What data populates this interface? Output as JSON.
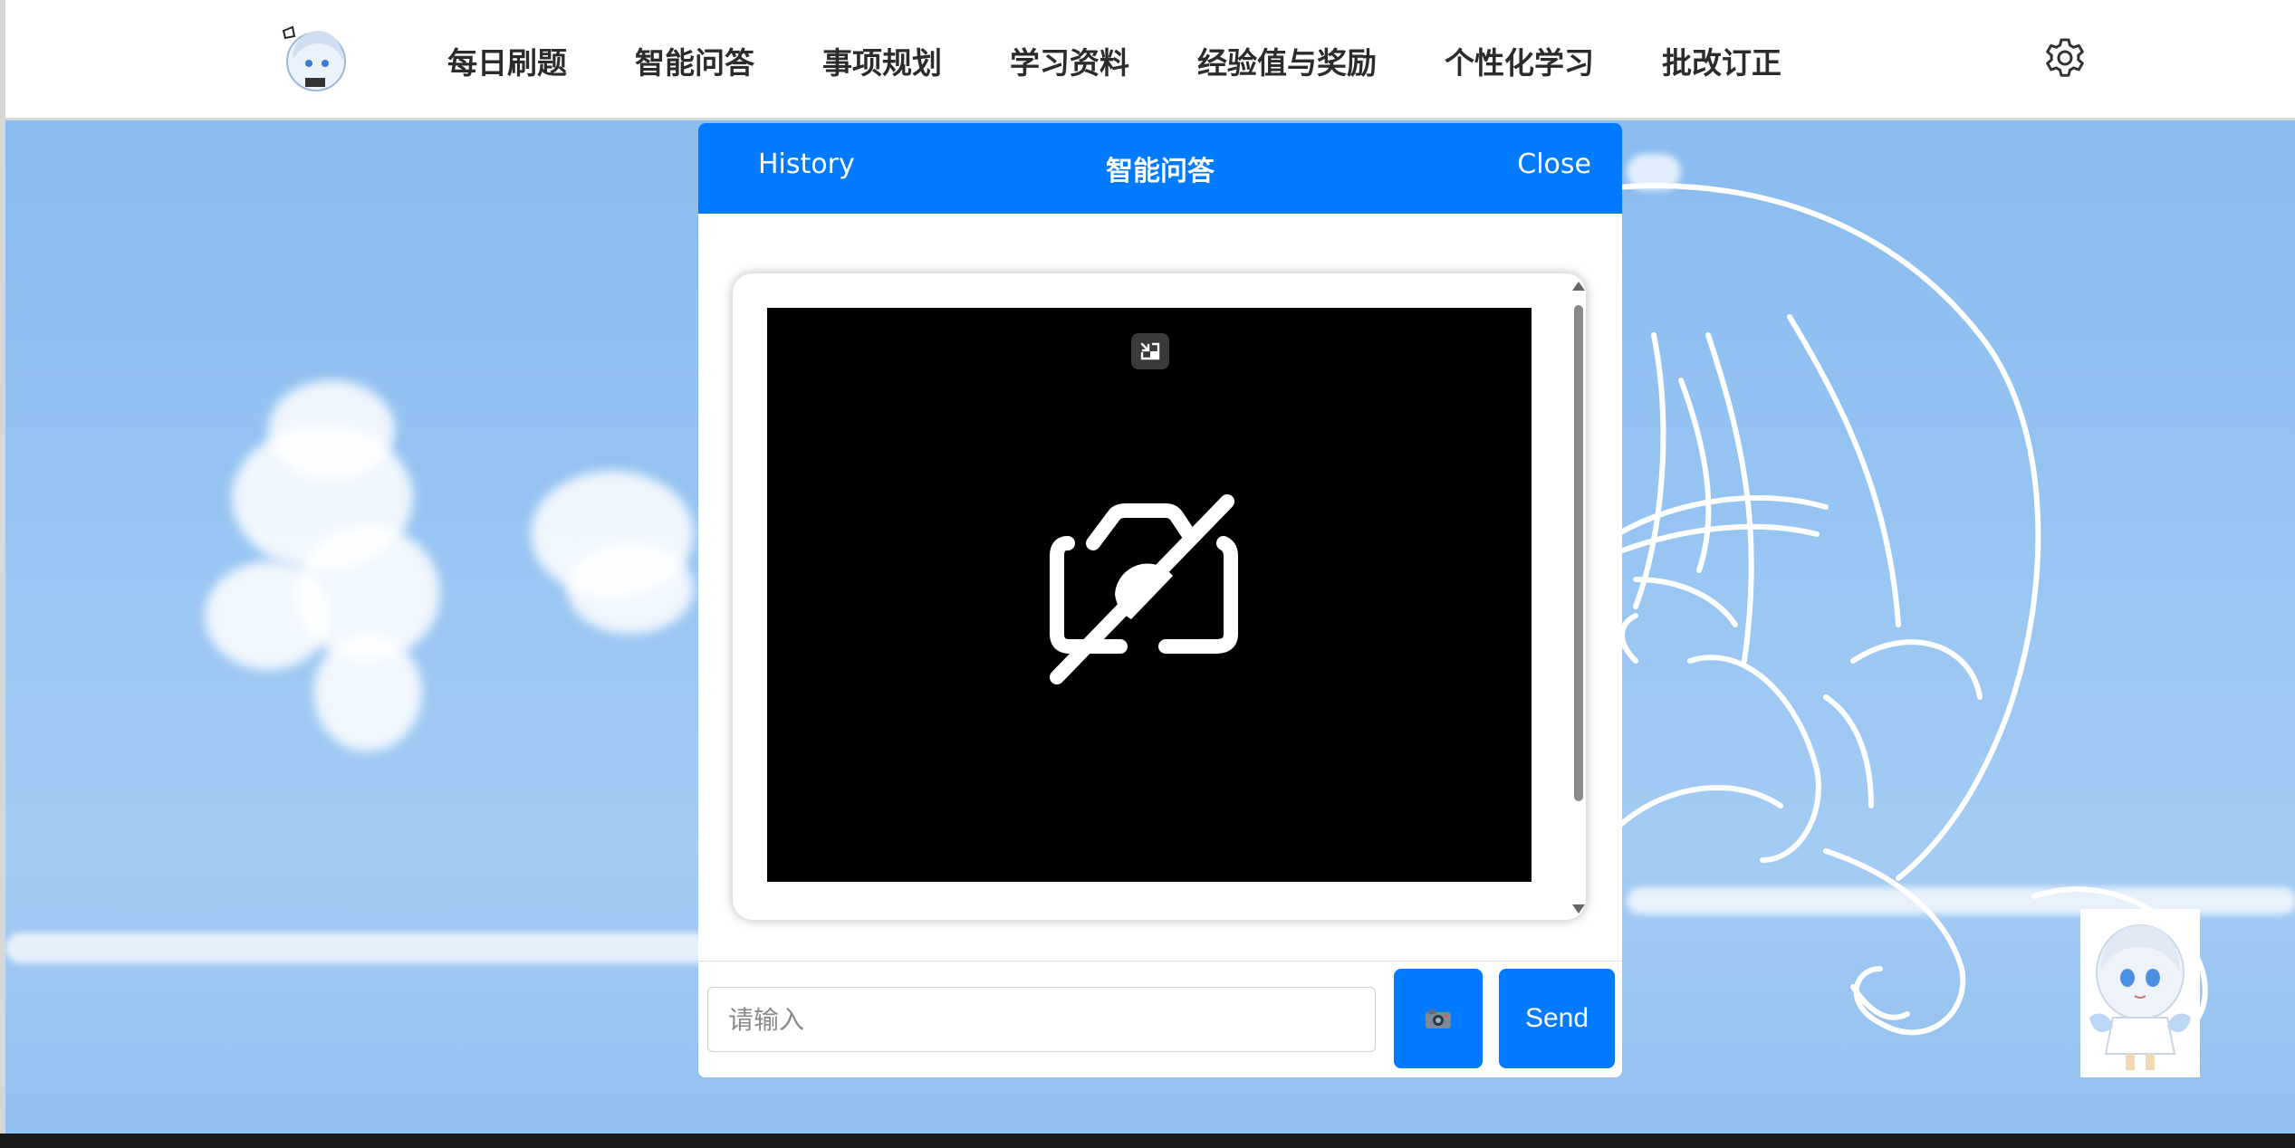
{
  "nav": {
    "links": [
      "每日刷题",
      "智能问答",
      "事项规划",
      "学习资料",
      "经验值与奖励",
      "个性化学习",
      "批改订正"
    ],
    "logo_icon": "anime-mascot-logo",
    "settings_icon": "gear-icon"
  },
  "chat": {
    "history_label": "History",
    "title": "智能问答",
    "close_label": "Close",
    "input_placeholder": "请输入",
    "camera_button_icon": "camera-icon",
    "send_label": "Send",
    "video_state_icon": "camera-off-icon",
    "pip_icon": "picture-in-picture-icon"
  },
  "colors": {
    "accent": "#007bff",
    "nav_text": "#2b2b2b",
    "sky": "#94c3f2"
  }
}
